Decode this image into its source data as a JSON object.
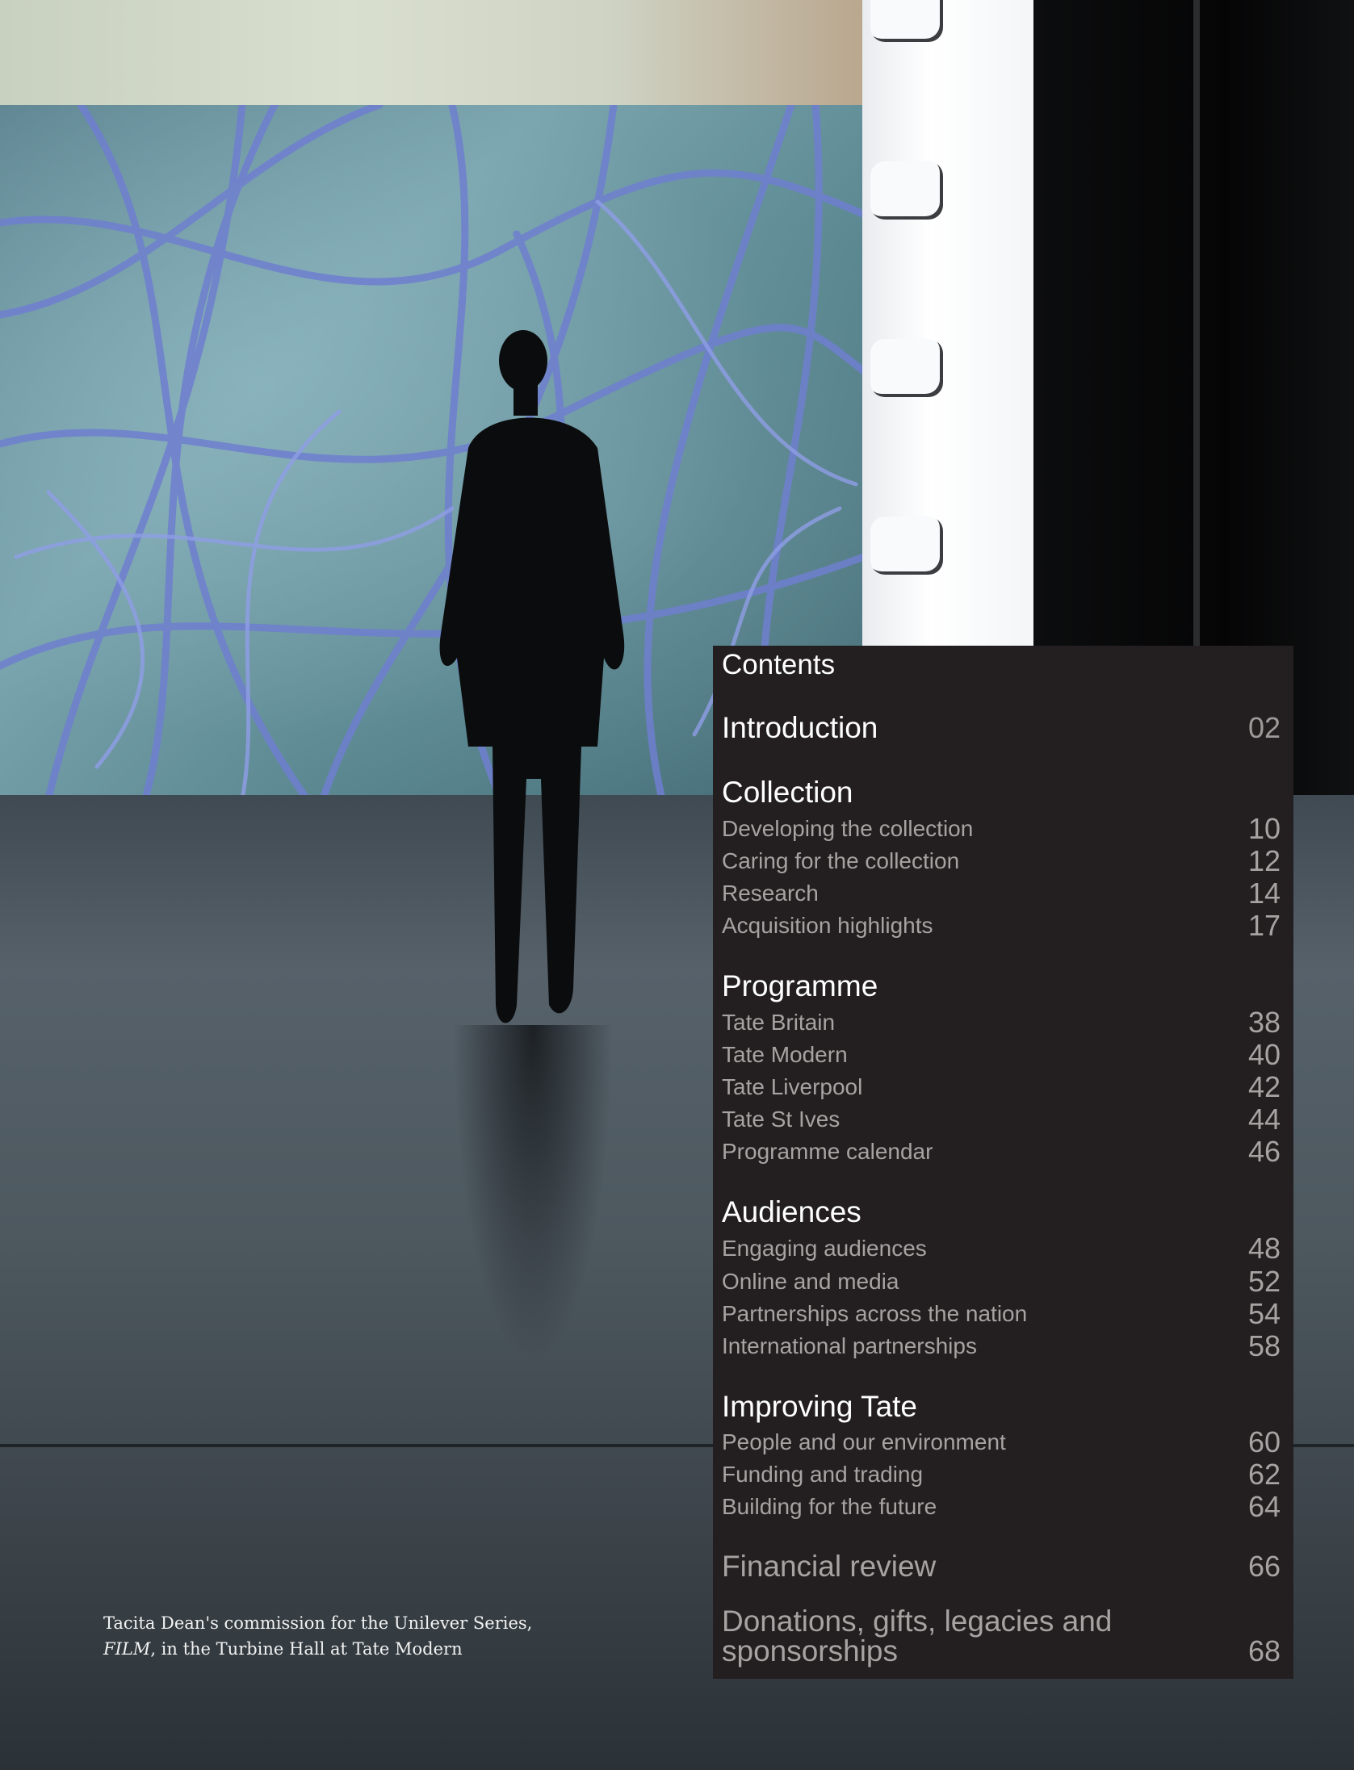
{
  "caption": {
    "line1": "Tacita Dean's commission for the Unilever Series,",
    "film_title": "FILM",
    "line2_rest": ", in the Turbine Hall at Tate Modern"
  },
  "contents": {
    "title": "Contents",
    "introduction": {
      "label": "Introduction",
      "page": "02"
    },
    "collection": {
      "heading": "Collection",
      "items": [
        {
          "label": "Developing the collection",
          "page": "10"
        },
        {
          "label": "Caring for the collection",
          "page": "12"
        },
        {
          "label": "Research",
          "page": "14"
        },
        {
          "label": "Acquisition highlights",
          "page": "17"
        }
      ]
    },
    "programme": {
      "heading": "Programme",
      "items": [
        {
          "label": "Tate Britain",
          "page": "38"
        },
        {
          "label": "Tate Modern",
          "page": "40"
        },
        {
          "label": "Tate Liverpool",
          "page": "42"
        },
        {
          "label": "Tate St Ives",
          "page": "44"
        },
        {
          "label": "Programme calendar",
          "page": "46"
        }
      ]
    },
    "audiences": {
      "heading": "Audiences",
      "items": [
        {
          "label": "Engaging audiences",
          "page": "48"
        },
        {
          "label": "Online and media",
          "page": "52"
        },
        {
          "label": "Partnerships across the nation",
          "page": "54"
        },
        {
          "label": "International partnerships",
          "page": "58"
        }
      ]
    },
    "improving": {
      "heading": "Improving Tate",
      "items": [
        {
          "label": "People and our environment",
          "page": "60"
        },
        {
          "label": "Funding and trading",
          "page": "62"
        },
        {
          "label": "Building for the future",
          "page": "64"
        }
      ]
    },
    "financial_review": {
      "label": "Financial review",
      "page": "66"
    },
    "donations": {
      "label": "Donations, gifts, legacies and sponsorships",
      "page": "68"
    }
  },
  "colors": {
    "panel_background": "#231f20",
    "heading_text": "#ffffff",
    "sub_text": "#a7a3a2"
  }
}
